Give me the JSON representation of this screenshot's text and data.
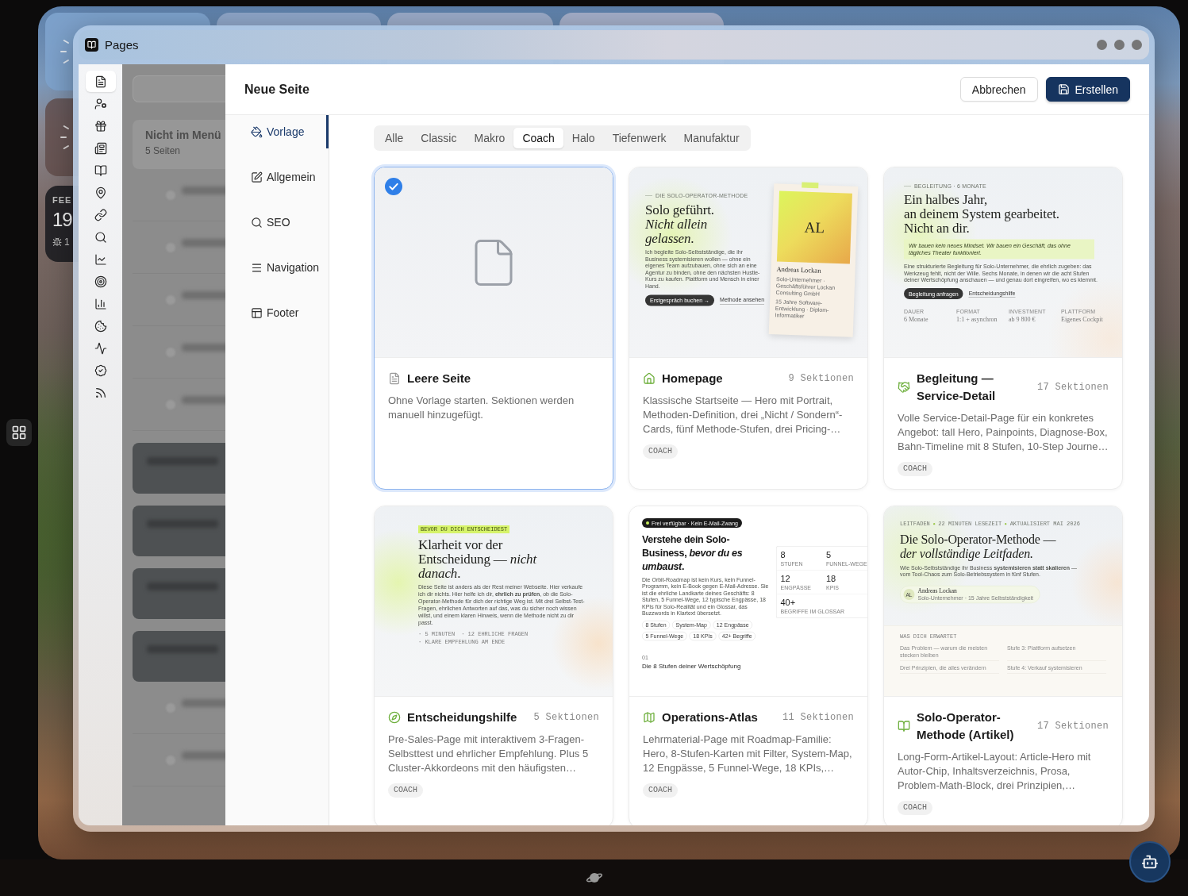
{
  "desktop": {
    "date_widget": {
      "month": "FEE",
      "day": "19",
      "weather": "1"
    }
  },
  "window": {
    "title": "Pages"
  },
  "sidebar": {
    "items": [
      {
        "selected": true
      },
      {
        "selected": false
      },
      {
        "selected": false
      },
      {
        "selected": false
      },
      {
        "selected": false
      },
      {
        "selected": false
      },
      {
        "selected": false
      },
      {
        "selected": false
      },
      {
        "selected": false
      },
      {
        "selected": false
      },
      {
        "selected": false
      },
      {
        "selected": false
      },
      {
        "selected": false
      },
      {
        "selected": false
      },
      {
        "selected": false
      }
    ]
  },
  "page_list": {
    "group_title": "Nicht im Menü",
    "group_count": "5 Seiten"
  },
  "dialog": {
    "title": "Neue Seite",
    "actions": [
      {
        "label": "Abbrechen",
        "kind": "secondary"
      },
      {
        "label": "Erstellen",
        "kind": "primary"
      }
    ],
    "nav": [
      {
        "label": "Vorlage",
        "selected": true
      },
      {
        "label": "Allgemein",
        "selected": false
      },
      {
        "label": "SEO",
        "selected": false
      },
      {
        "label": "Navigation",
        "selected": false
      },
      {
        "label": "Footer",
        "selected": false
      }
    ],
    "filters": [
      {
        "label": "Alle",
        "selected": false
      },
      {
        "label": "Classic",
        "selected": false
      },
      {
        "label": "Makro",
        "selected": false
      },
      {
        "label": "Coach",
        "selected": true
      },
      {
        "label": "Halo",
        "selected": false
      },
      {
        "label": "Tiefenwerk",
        "selected": false
      },
      {
        "label": "Manufaktur",
        "selected": false
      }
    ],
    "templates": [
      {
        "title": "Leere Seite",
        "selected": true,
        "description": "Ohne Vorlage starten. Sektionen werden manuell hinzugefügt.",
        "preview": {
          "kind": "blank"
        }
      },
      {
        "title": "Homepage",
        "sections": "9 Sektionen",
        "selected": false,
        "description": "Klassische Startseite — Hero mit Portrait, Methoden-Definition, drei „Nicht / Sondern“-Cards, fünf Methode-Stufen, drei Pricing-…",
        "tag": "COACH",
        "preview": {
          "kind": "homepage",
          "eyebrow": "DIE SOLO-OPERATOR-METHODE",
          "headline": [
            "Solo geführt.",
            "*Nicht allein*",
            "*gelassen*."
          ],
          "text": "Ich begleite Solo-Selbstständige, die ihr Business systemisieren wollen — ohne ein eigenes Team aufzubauen, ohne sich an eine Agentur zu binden, ohne den nächsten Hustle-Kurs zu kaufen. Plattform und Mensch in einer Hand.",
          "button": "Erstgespräch buchen →",
          "link": "Methode ansehen",
          "portrait": {
            "initials": "AL",
            "name": "Andreas Lockan",
            "lines": [
              "Solo-Unternehmer · Geschäftsführer Lockan Consulting GmbH",
              "15 Jahre Software-Entwicklung · Diplom-Informatiker"
            ]
          }
        }
      },
      {
        "title": "Begleitung — Service-Detail",
        "sections": "17 Sektionen",
        "selected": false,
        "description": "Volle Service-Detail-Page für ein konkretes Angebot: tall Hero, Painpoints, Diagnose-Box, Bahn-Timeline mit 8 Stufen, 10-Step Journe…",
        "tag": "COACH",
        "preview": {
          "kind": "service",
          "eyebrow": "BEGLEITUNG · 6 MONATE",
          "headline": [
            "Ein halbes Jahr,",
            "an deinem System gearbeitet.",
            "Nicht an dir."
          ],
          "callout": "Wir bauen kein neues Mindset. Wir bauen ein Geschäft, das ohne tägliches Theater funktioniert.",
          "text": "Eine strukturierte Begleitung für Solo-Unternehmer, die ehrlich zugeben: das Werkzeug fehlt, nicht der Wille. Sechs Monate, in denen wir die acht Stufen deiner Wertschöpfung anschauen — und genau dort eingreifen, wo es klemmt.",
          "button": "Begleitung anfragen",
          "link": "Entscheidungshilfe",
          "facts": [
            {
              "label": "DAUER",
              "value": "6 Monate"
            },
            {
              "label": "FORMAT",
              "value": "1:1 + asynchron"
            },
            {
              "label": "INVESTMENT",
              "value": "ab 9 800 €"
            },
            {
              "label": "PLATTFORM",
              "value": "Eigenes Cockpit"
            }
          ]
        }
      },
      {
        "title": "Entscheidungshilfe",
        "sections": "5 Sektionen",
        "selected": false,
        "description": "Pre-Sales-Page mit interaktivem 3-Fragen-Selbsttest und ehrlicher Empfehlung. Plus 5 Cluster-Akkordeons mit den häufigsten…",
        "tag": "COACH",
        "preview": {
          "kind": "decision",
          "badge": "BEVOR DU DICH ENTSCHEIDEST",
          "headline": [
            "Klarheit vor der",
            "Entscheidung — *nicht*",
            "*danach*."
          ],
          "text": "Diese Seite ist anders als der Rest meiner Webseite. Hier verkaufe ich dir nichts. Hier helfe ich dir, **ehrlich zu prüfen**, ob die Solo-Operator-Methode für dich der richtige Weg ist. Mit drei Selbst-Test-Fragen, ehrlichen Antworten auf das, was du sicher noch wissen willst, und einem klaren Hinweis, wenn die Methode nicht zu dir passt.",
          "meta": [
            "· 5 MINUTEN",
            "· 12 EHRLICHE FRAGEN",
            "· KLARE EMPFEHLUNG AM ENDE"
          ]
        }
      },
      {
        "title": "Operations-Atlas",
        "sections": "11 Sektionen",
        "selected": false,
        "description": "Lehrmaterial-Page mit Roadmap-Familie: Hero, 8-Stufen-Karten mit Filter, System-Map, 12 Engpässe, 5 Funnel-Wege, 18 KPIs,…",
        "tag": "COACH",
        "preview": {
          "kind": "atlas",
          "badge": "Frei verfügbar · Kein E-Mail-Zwang",
          "headline": [
            "Verstehe dein Solo-",
            "Business, *bevor du es*",
            "*umbaust*."
          ],
          "text": "Die Orbit-Roadmap ist kein Kurs, kein Funnel-Programm, kein E-Book gegen E-Mail-Adresse. Sie ist die ehrliche Landkarte deines Geschäfts: 8 Stufen, 5 Funnel-Wege, 12 typische Engpässe, 18 KPIs für Solo-Realität und ein Glossar, das Buzzwords in Klartext übersetzt.",
          "chips": [
            "8 Stufen",
            "System-Map",
            "12 Engpässe",
            "5 Funnel-Wege",
            "18 KPIs",
            "42+ Begriffe"
          ],
          "stats": [
            {
              "value": "8",
              "label": "STUFEN"
            },
            {
              "value": "5",
              "label": "FUNNEL-WEGE"
            },
            {
              "value": "12",
              "label": "ENGPÄSSE"
            },
            {
              "value": "18",
              "label": "KPIS"
            },
            {
              "value": "40+",
              "label": "BEGRIFFE IM GLOSSAR"
            }
          ],
          "section_number": "01",
          "section_title": "Die 8 Stufen deiner Wertschöpfung"
        }
      },
      {
        "title": "Solo-Operator-Methode (Artikel)",
        "sections": "17 Sektionen",
        "selected": false,
        "description": "Long-Form-Artikel-Layout: Article-Hero mit Autor-Chip, Inhaltsverzeichnis, Prosa, Problem-Math-Block, drei Prinzipien,…",
        "tag": "COACH",
        "preview": {
          "kind": "article",
          "eyebrow": [
            "LEITFADEN",
            "22 MINUTEN LESEZEIT",
            "AKTUALISIERT MAI 2026"
          ],
          "headline": [
            "Die Solo-Operator-Methode —",
            "*der vollständige Leitfaden.*"
          ],
          "text": "Wie Solo-Selbstständige ihr Business **systemisieren statt skalieren** —\nvom Tool-Chaos zum Solo-Betriebssystem in fünf Stufen.",
          "author": {
            "initials": "AL",
            "name": "Andreas Lockan",
            "role": "Solo-Unternehmer · 15 Jahre Selbstständigkeit"
          },
          "toc_title": "WAS DICH ERWARTET",
          "toc": [
            "Das Problem — warum die meisten stecken bleiben",
            "Stufe 3: Plattform aufsetzen",
            "Drei Prinzipien, die alles verändern",
            "Stufe 4: Verkauf systemisieren"
          ]
        }
      }
    ]
  }
}
